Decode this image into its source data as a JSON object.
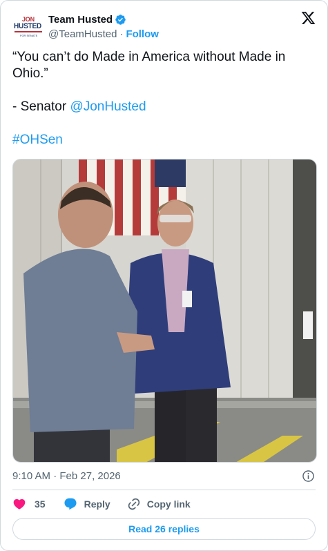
{
  "account": {
    "display_name": "Team Husted",
    "handle": "@TeamHusted",
    "separator": "·",
    "follow_label": "Follow",
    "avatar_lettering": [
      "JON",
      "HUSTED",
      "FOR SENATE"
    ]
  },
  "tweet": {
    "quote_line_1": "“You can’t do Made in America without Made in",
    "quote_line_2": "Ohio.”",
    "attribution_prefix": "- Senator ",
    "mention": "@JonHusted",
    "hashtag": "#OHSen"
  },
  "timestamp": "9:10 AM · Feb 27, 2026",
  "actions": {
    "likes_count": "35",
    "reply_label": "Reply",
    "copy_link_label": "Copy link"
  },
  "read_replies_label": "Read 26 replies",
  "colors": {
    "accent": "#1d9bf0",
    "like": "#f91880",
    "text_primary": "#0f1419",
    "text_secondary": "#536471",
    "border": "#cfd9de",
    "avatar_red": "#b8323a",
    "avatar_blue": "#1f3a68"
  },
  "icons": [
    "verified-badge-icon",
    "x-logo-icon",
    "info-icon",
    "heart-icon",
    "reply-bubble-icon",
    "link-icon"
  ]
}
